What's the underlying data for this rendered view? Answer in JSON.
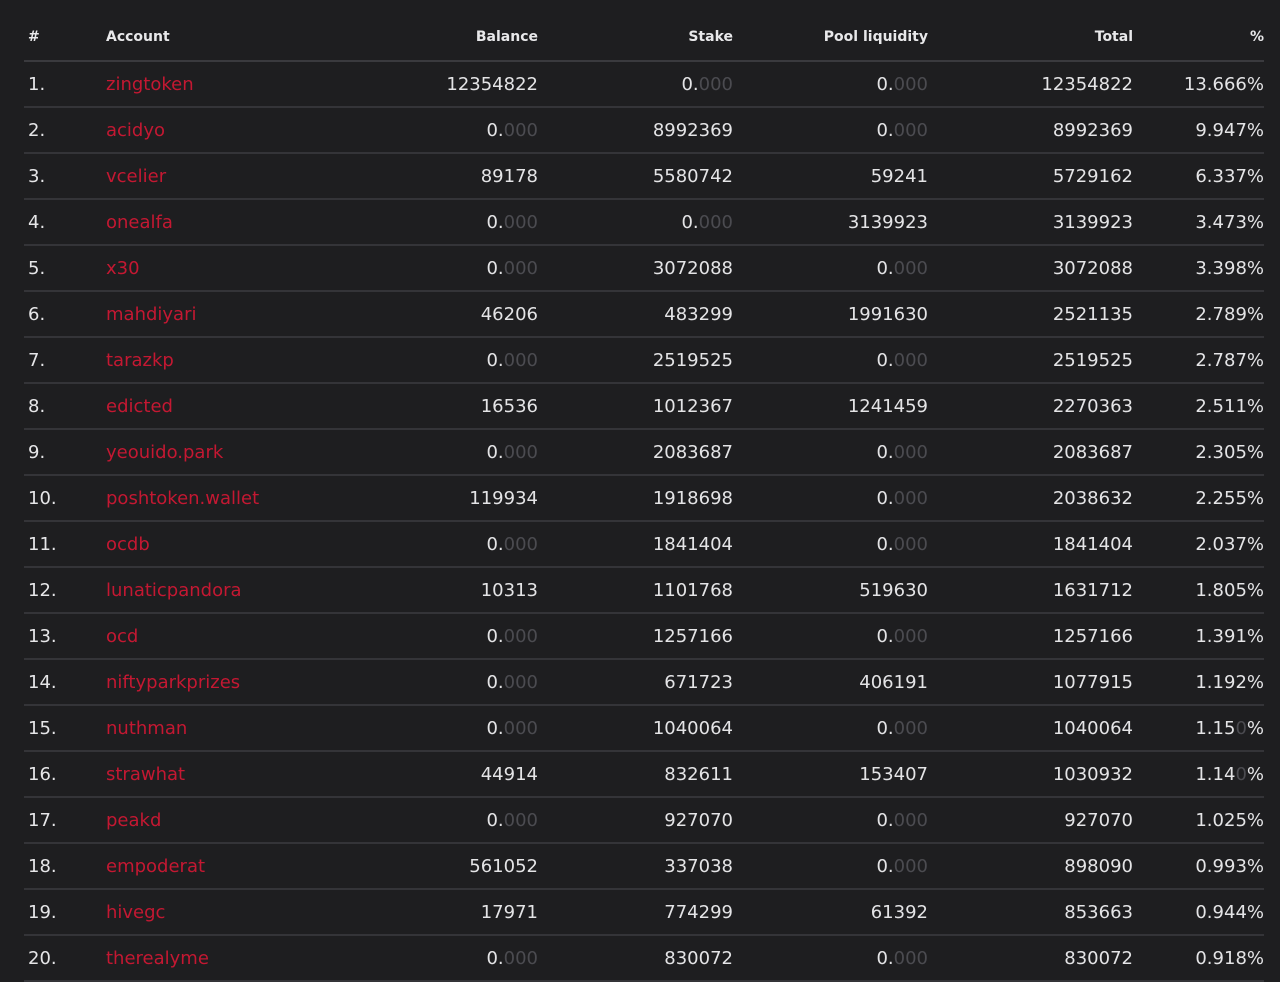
{
  "columns": [
    "#",
    "Account",
    "Balance",
    "Stake",
    "Pool liquidity",
    "Total",
    "%"
  ],
  "colors": {
    "background": "#1e1e20",
    "account_link": "#c41832",
    "text": "#e4e4e6",
    "dim_decimals": "#4b4b50"
  },
  "rows": [
    {
      "rank": "1.",
      "account": "zingtoken",
      "balance": "12354822",
      "stake": "0.000",
      "pool": "0.000",
      "total": "12354822",
      "pct": "13.666%"
    },
    {
      "rank": "2.",
      "account": "acidyo",
      "balance": "0.000",
      "stake": "8992369",
      "pool": "0.000",
      "total": "8992369",
      "pct": "9.947%"
    },
    {
      "rank": "3.",
      "account": "vcelier",
      "balance": "89178",
      "stake": "5580742",
      "pool": "59241",
      "total": "5729162",
      "pct": "6.337%"
    },
    {
      "rank": "4.",
      "account": "onealfa",
      "balance": "0.000",
      "stake": "0.000",
      "pool": "3139923",
      "total": "3139923",
      "pct": "3.473%"
    },
    {
      "rank": "5.",
      "account": "x30",
      "balance": "0.000",
      "stake": "3072088",
      "pool": "0.000",
      "total": "3072088",
      "pct": "3.398%"
    },
    {
      "rank": "6.",
      "account": "mahdiyari",
      "balance": "46206",
      "stake": "483299",
      "pool": "1991630",
      "total": "2521135",
      "pct": "2.789%"
    },
    {
      "rank": "7.",
      "account": "tarazkp",
      "balance": "0.000",
      "stake": "2519525",
      "pool": "0.000",
      "total": "2519525",
      "pct": "2.787%"
    },
    {
      "rank": "8.",
      "account": "edicted",
      "balance": "16536",
      "stake": "1012367",
      "pool": "1241459",
      "total": "2270363",
      "pct": "2.511%"
    },
    {
      "rank": "9.",
      "account": "yeouido.park",
      "balance": "0.000",
      "stake": "2083687",
      "pool": "0.000",
      "total": "2083687",
      "pct": "2.305%"
    },
    {
      "rank": "10.",
      "account": "poshtoken.wallet",
      "balance": "119934",
      "stake": "1918698",
      "pool": "0.000",
      "total": "2038632",
      "pct": "2.255%"
    },
    {
      "rank": "11.",
      "account": "ocdb",
      "balance": "0.000",
      "stake": "1841404",
      "pool": "0.000",
      "total": "1841404",
      "pct": "2.037%"
    },
    {
      "rank": "12.",
      "account": "lunaticpandora",
      "balance": "10313",
      "stake": "1101768",
      "pool": "519630",
      "total": "1631712",
      "pct": "1.805%"
    },
    {
      "rank": "13.",
      "account": "ocd",
      "balance": "0.000",
      "stake": "1257166",
      "pool": "0.000",
      "total": "1257166",
      "pct": "1.391%"
    },
    {
      "rank": "14.",
      "account": "niftyparkprizes",
      "balance": "0.000",
      "stake": "671723",
      "pool": "406191",
      "total": "1077915",
      "pct": "1.192%"
    },
    {
      "rank": "15.",
      "account": "nuthman",
      "balance": "0.000",
      "stake": "1040064",
      "pool": "0.000",
      "total": "1040064",
      "pct": "1.150%"
    },
    {
      "rank": "16.",
      "account": "strawhat",
      "balance": "44914",
      "stake": "832611",
      "pool": "153407",
      "total": "1030932",
      "pct": "1.140%"
    },
    {
      "rank": "17.",
      "account": "peakd",
      "balance": "0.000",
      "stake": "927070",
      "pool": "0.000",
      "total": "927070",
      "pct": "1.025%"
    },
    {
      "rank": "18.",
      "account": "empoderat",
      "balance": "561052",
      "stake": "337038",
      "pool": "0.000",
      "total": "898090",
      "pct": "0.993%"
    },
    {
      "rank": "19.",
      "account": "hivegc",
      "balance": "17971",
      "stake": "774299",
      "pool": "61392",
      "total": "853663",
      "pct": "0.944%"
    },
    {
      "rank": "20.",
      "account": "therealyme",
      "balance": "0.000",
      "stake": "830072",
      "pool": "0.000",
      "total": "830072",
      "pct": "0.918%"
    }
  ]
}
